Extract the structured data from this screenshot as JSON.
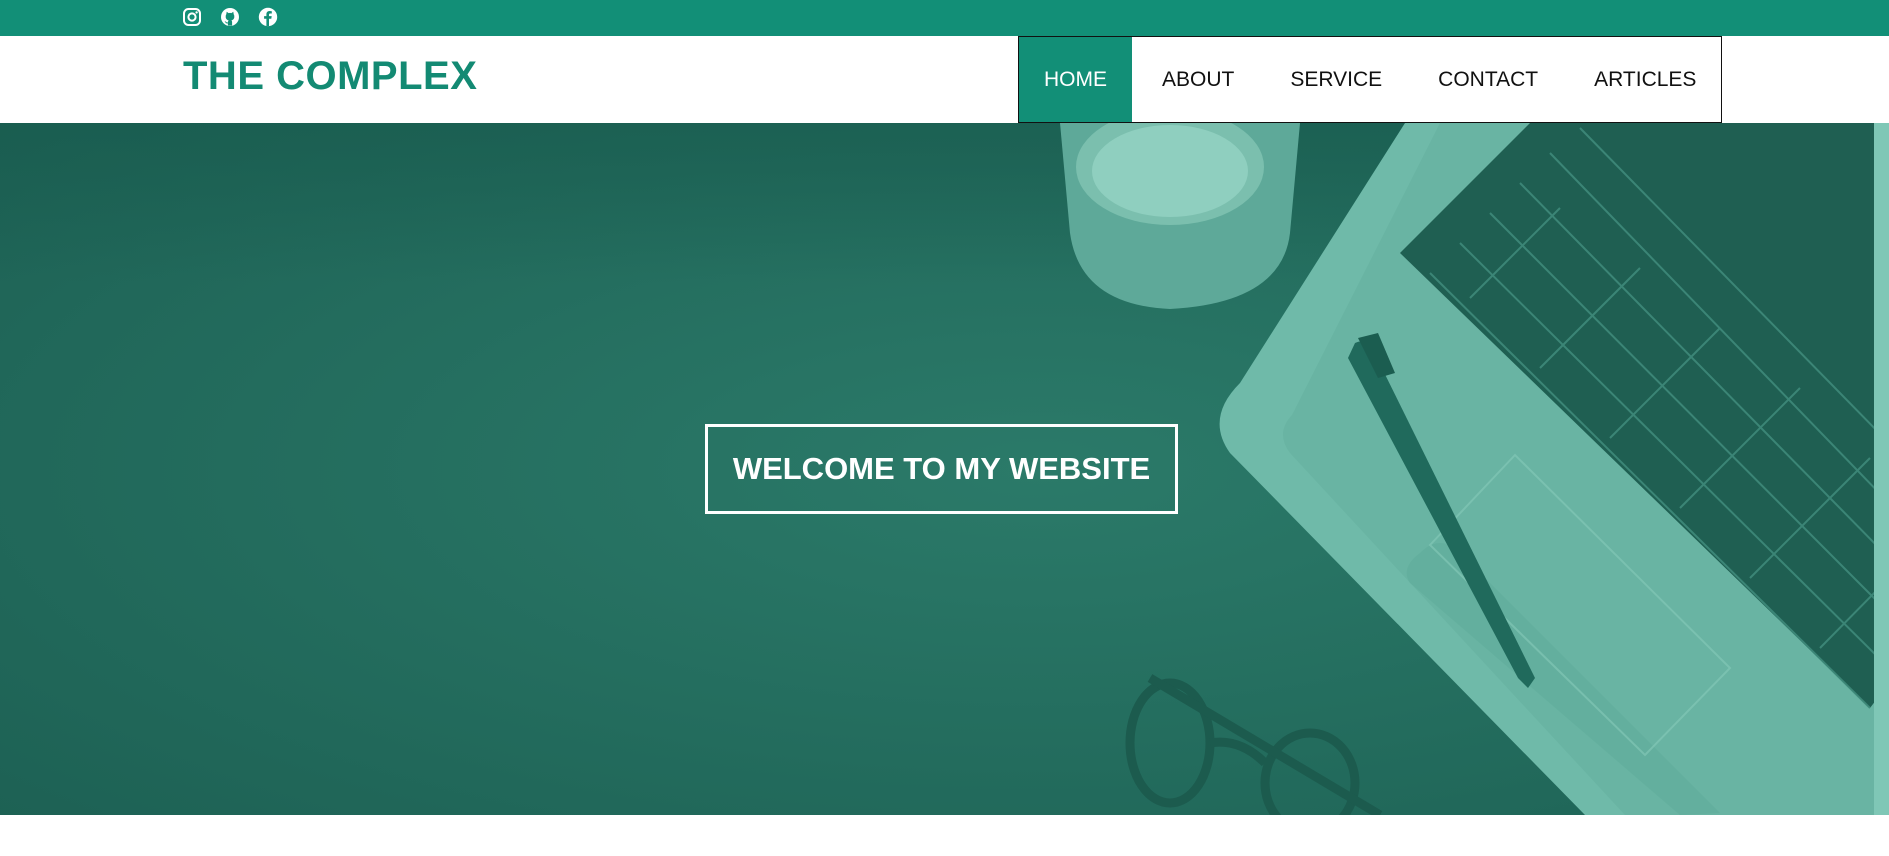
{
  "social": {
    "icons": [
      "instagram-icon",
      "github-icon",
      "facebook-icon"
    ]
  },
  "brand": {
    "title": "THE COMPLEX",
    "color": "#138a73"
  },
  "nav": {
    "items": [
      {
        "label": "HOME",
        "active": true
      },
      {
        "label": "ABOUT",
        "active": false
      },
      {
        "label": "SERVICE",
        "active": false
      },
      {
        "label": "CONTACT",
        "active": false
      },
      {
        "label": "ARTICLES",
        "active": false
      }
    ]
  },
  "hero": {
    "headline": "WELCOME TO MY WEBSITE",
    "overlay_color": "#256f60"
  },
  "colors": {
    "accent": "#128f77"
  }
}
